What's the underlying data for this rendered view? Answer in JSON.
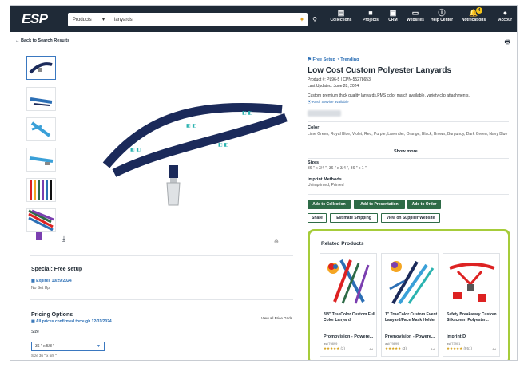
{
  "app": {
    "logo": "ESP"
  },
  "search": {
    "scope": "Products",
    "query": "lanyards"
  },
  "nav": [
    {
      "label": "Collections",
      "icon": "collections-icon"
    },
    {
      "label": "Projects",
      "icon": "folder-icon"
    },
    {
      "label": "CRM",
      "icon": "crm-icon"
    },
    {
      "label": "Websites",
      "icon": "monitor-icon"
    },
    {
      "label": "Help Center",
      "icon": "info-icon"
    },
    {
      "label": "Notifications",
      "icon": "bell-icon",
      "badge": "4"
    },
    {
      "label": "Accour",
      "icon": "user-icon"
    }
  ],
  "back_label": "← Back to Search Results",
  "product": {
    "tags": "⚑ Free Setup   ◔ Trending",
    "title": "Low Cost Custom Polyester Lanyards",
    "number": "Product #: PL96-5 | CPN-55278653",
    "updated": "Last Updated: June 28, 2024",
    "description": "Custom premium thick quality lanyards.PMS color match available, variety clip attachments.",
    "rush": "⦿ Rush Service available",
    "color_label": "Color",
    "colors": "Lime Green, Royal Blue, Violet, Red, Purple, Lavender, Orange, Black, Brown, Burgundy, Dark Green, Navy Blue",
    "show_more": "Show more",
    "sizes_label": "Sizes",
    "sizes": "36 \" x 3/4 \", 36 \" x 3/4 \", 36 \" x 1 \"",
    "imprint_label": "Imprint Methods",
    "imprint": "Unimprinted, Printed",
    "buttons": {
      "add_collection": "Add to Collection",
      "add_presentation": "Add to Presentation",
      "add_order": "Add to Order",
      "share": "Share",
      "estimate": "Estimate Shipping",
      "supplier": "View on Supplier Website"
    }
  },
  "special": {
    "title": "Special: Free setup",
    "expires": "▦ Expires 10/29/2024",
    "note": "No Set Up"
  },
  "pricing": {
    "title": "Pricing Options",
    "confirmed": "▦ All prices confirmed through 12/31/2024",
    "view_all": "View all Price Grids",
    "size_label": "Size",
    "size_value": "36 \" x 5/8 \"",
    "size_note": "Size 36 \" x 5/8 \""
  },
  "related": {
    "title": "Related Products",
    "cards": [
      {
        "title": "3/8\" TrueColor Custom Full Color Lanyard",
        "supplier": "Promovision - Powere...",
        "asi": "asi/79899",
        "rating": "★★★★★",
        "count": "(3)",
        "ad": "Ad"
      },
      {
        "title": "1\" TrueColor Custom Event Lanyard/Face Mask Holder",
        "supplier": "Promovision - Powere...",
        "asi": "asi/79899",
        "rating": "★★★★★",
        "count": "(3)",
        "ad": "Ad"
      },
      {
        "title": "Safety Breakaway Custom Silkscreen Polyester...",
        "supplier": "ImprintID",
        "asi": "asi/73901",
        "rating": "★★★★★",
        "count": "(951)",
        "ad": "Ad"
      }
    ]
  },
  "colors": {
    "nav_bg": "#1f2a37",
    "primary_green": "#2e6b47",
    "link_blue": "#2c6fb5",
    "highlight": "#a6cc3a",
    "lanyard_navy": "#1b2a5a",
    "lanyard_teal": "#2bb3b0"
  }
}
